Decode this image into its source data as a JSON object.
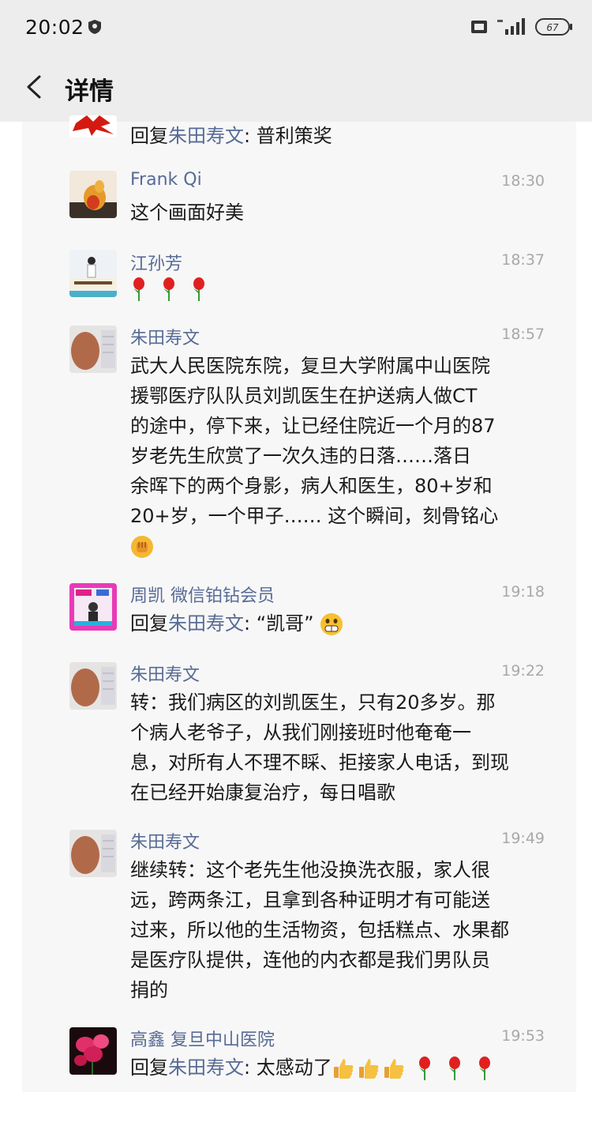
{
  "status_bar": {
    "time": "20:02",
    "battery": "67"
  },
  "nav": {
    "title": "详情"
  },
  "top_reply": {
    "prefix": "回复",
    "reply_to": "朱田寿文",
    "text": ": 普利策奖"
  },
  "comments": [
    {
      "name": "Frank Qi",
      "time": "18:30",
      "text": "这个画面好美"
    },
    {
      "name": "江孙芳",
      "time": "18:37",
      "emoji": [
        "rose",
        "rose",
        "rose"
      ]
    },
    {
      "name": "朱田寿文",
      "time": "18:57",
      "lines": [
        "武大人民医院东院，复旦大学附属中山医院",
        "援鄂医疗队队员刘凯医生在护送病人做CT",
        "的途中，停下来，让已经住院近一个月的87",
        "岁老先生欣赏了一次久违的日落……落日",
        "余晖下的两个身影，病人和医生，80+岁和",
        "20+岁，一个甲子…… 这个瞬间，刻骨铭心"
      ],
      "emoji": [
        "fist"
      ]
    },
    {
      "name": "周凯 微信铂钻会员",
      "time": "19:18",
      "prefix": "回复",
      "reply_to": "朱田寿文",
      "text": ": “凯哥”",
      "emoji": [
        "grin"
      ]
    },
    {
      "name": "朱田寿文",
      "time": "19:22",
      "lines": [
        "转：我们病区的刘凯医生，只有20多岁。那",
        "个病人老爷子，从我们刚接班时他奄奄一",
        "息，对所有人不理不睬、拒接家人电话，到现",
        "在已经开始康复治疗，每日唱歌"
      ]
    },
    {
      "name": "朱田寿文",
      "time": "19:49",
      "lines": [
        "继续转：这个老先生他没换洗衣服，家人很",
        "远，跨两条江，且拿到各种证明才有可能送",
        "过来，所以他的生活物资，包括糕点、水果都",
        "是医疗队提供，连他的内衣都是我们男队员",
        "捐的"
      ]
    },
    {
      "name": "高鑫  复旦中山医院",
      "time": "19:53",
      "prefix": "回复",
      "reply_to": "朱田寿文",
      "text": ": 太感动了",
      "emoji": [
        "thumbs-up",
        "thumbs-up",
        "thumbs-up",
        "rose",
        "rose",
        "rose"
      ]
    }
  ]
}
